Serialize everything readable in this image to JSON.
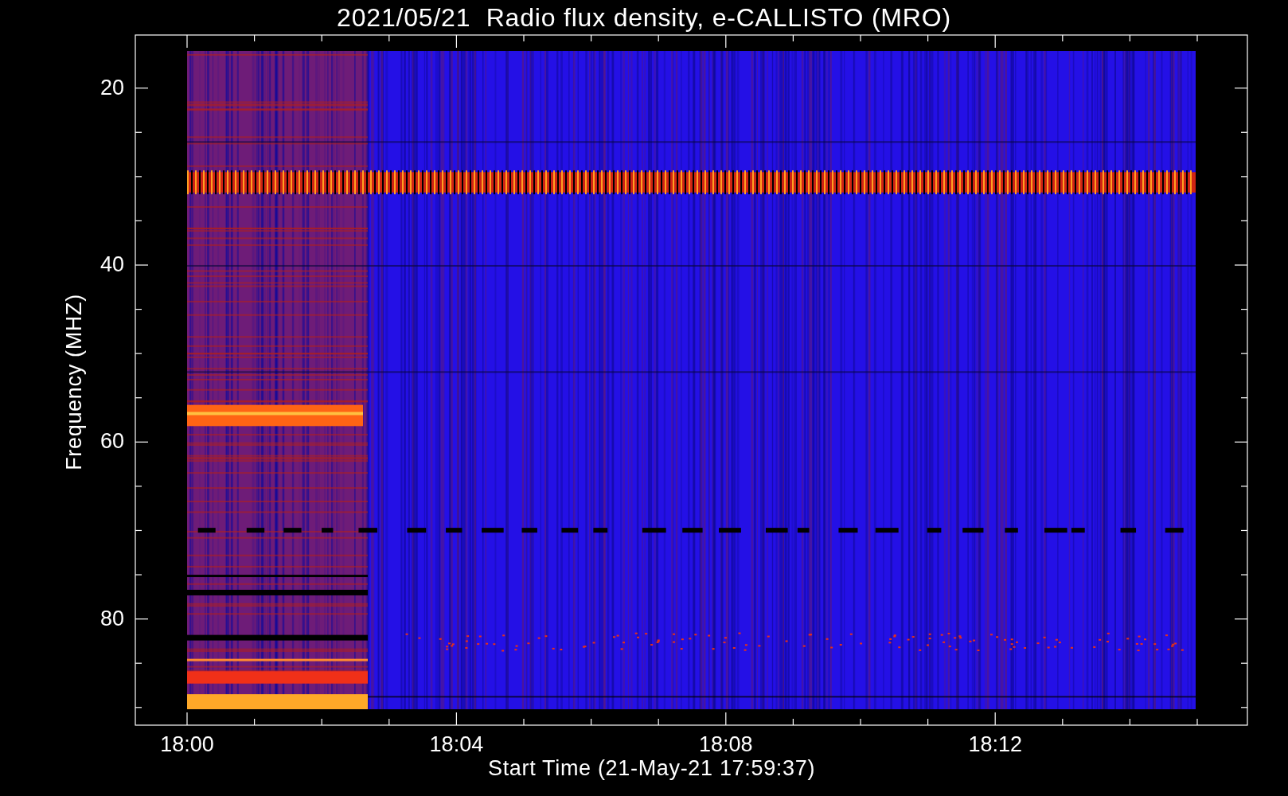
{
  "title": "2021/05/21  Radio flux density, e-CALLISTO (MRO)",
  "y_axis": {
    "label": "Frequency (MHZ)",
    "ticks": [
      "20",
      "40",
      "60",
      "80"
    ]
  },
  "x_axis": {
    "label": "Start Time (21-May-21 17:59:37)",
    "ticks": [
      "18:00",
      "18:04",
      "18:08",
      "18:12"
    ]
  }
}
